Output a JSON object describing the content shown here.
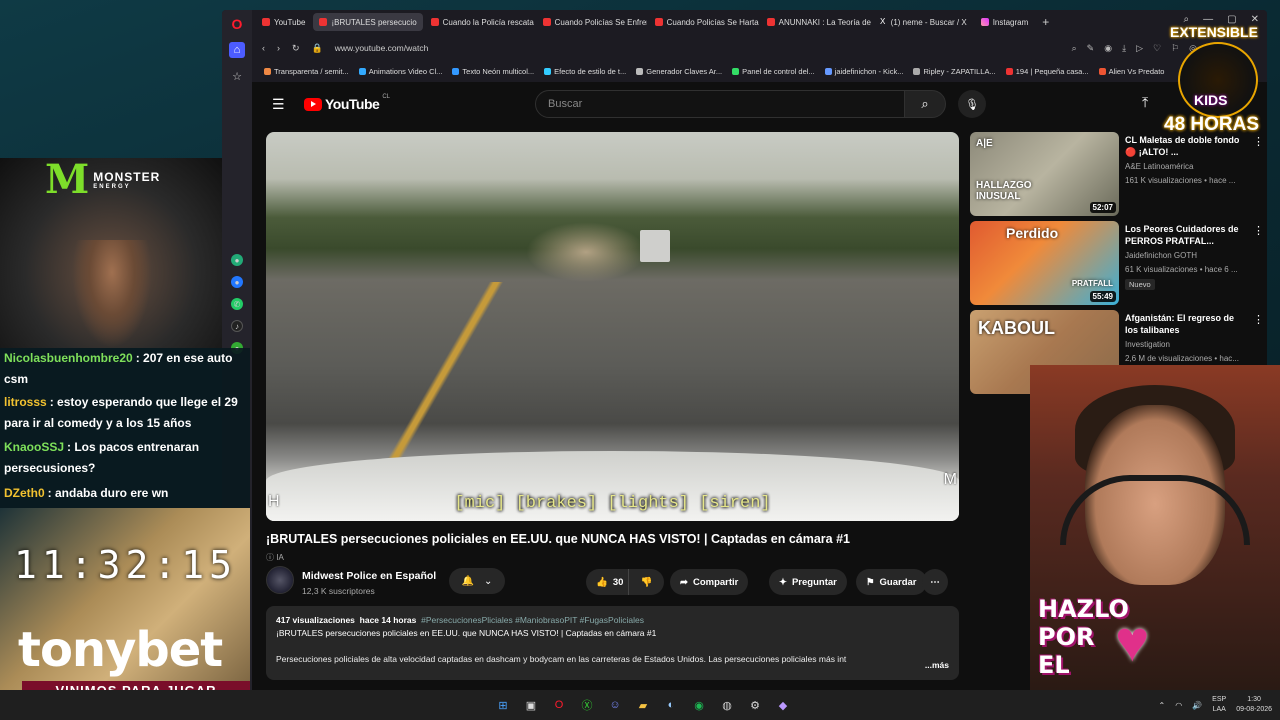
{
  "browser": {
    "tabs": [
      {
        "label": "YouTube",
        "icon": "youtube-icon"
      },
      {
        "label": "¡BRUTALES persecucio",
        "icon": "youtube-icon",
        "active": true
      },
      {
        "label": "Cuando la Policía rescata",
        "icon": "youtube-icon"
      },
      {
        "label": "Cuando Policías Se Enfren",
        "icon": "youtube-icon"
      },
      {
        "label": "Cuando Policías Se Hartan",
        "icon": "youtube-icon"
      },
      {
        "label": "ANUNNAKI : La Teoría de",
        "icon": "youtube-icon"
      },
      {
        "label": "(1) neme - Buscar / X",
        "icon": "x-icon"
      },
      {
        "label": "Instagram",
        "icon": "instagram-icon"
      }
    ],
    "url": "www.youtube.com/watch",
    "bookmarks": [
      "Transparenta / semit...",
      "Animations Video Cl...",
      "Texto Neón multicol...",
      "Efecto de estilo de t...",
      "Generador Claves Ar...",
      "Panel de control del...",
      "jaidefinichon - Kick...",
      "Ripley - ZAPATILLA...",
      "194 | Pequeña casa...",
      "Alien Vs Predato"
    ]
  },
  "youtube": {
    "logo_text": "YouTube",
    "logo_country": "CL",
    "search_placeholder": "Buscar",
    "video": {
      "subtitle": "[mic] [brakes] [lights] [siren]",
      "watermark_left": "H",
      "watermark_right": "M",
      "title": "¡BRUTALES persecuciones policiales en EE.UU. que NUNCA HAS VISTO! | Captadas en cámara #1",
      "ai_label": "IA",
      "channel": "Midwest Police en Español",
      "subscribers": "12,3 K suscriptores",
      "likes": "30",
      "share_label": "Compartir",
      "ask_label": "Preguntar",
      "save_label": "Guardar",
      "views": "417 visualizaciones",
      "age": "hace 14 horas",
      "tags": "#PersecucionesPliciales #ManiobrasoPIT #FugasPoliciales",
      "desc_line1": "¡BRUTALES persecuciones policiales en EE.UU. que NUNCA  HAS VISTO! | Captadas en cámara #1",
      "desc_body": "Persecuciones policiales de alta velocidad captadas en dashcam y bodycam en las carreteras de Estados Unidos. Las persecuciones policiales más int",
      "more_label": "...más"
    },
    "recommendations": [
      {
        "title": "CL Maletas de doble fondo 🔴 ¡ALTO! ...",
        "channel": "A&E Latinoamérica",
        "views": "161 K visualizaciones • hace ...",
        "duration": "52:07",
        "thumb_text": "HALLAZGO INUSUAL",
        "thumb_logo": "A|E",
        "badge": ""
      },
      {
        "title": "Los Peores Cuidadores de PERROS PRATFAL...",
        "channel": "Jaidefinichon GOTH",
        "views": "61 K visualizaciones • hace 6 ...",
        "duration": "55:49",
        "thumb_text": "Perdido",
        "thumb_logo": "PRATFALL",
        "badge": "Nuevo"
      },
      {
        "title": "Afganistán: El regreso de los talibanes",
        "channel": "Investigation",
        "views": "2,6 M de visualizaciones • hac...",
        "duration": "",
        "thumb_text": "KABOUL",
        "thumb_logo": "",
        "badge": ""
      }
    ]
  },
  "overlay": {
    "sponsor_logo": "MONSTER",
    "sponsor_sub": "ENERGY",
    "chat": [
      {
        "user": "Nicolasbuenhombre20",
        "msg": ": 207 en ese auto csm",
        "color": "#7ee05a"
      },
      {
        "user": "litrosss",
        "msg": ": estoy esperando que llege el 29 para ir al comedy y a los 15 años",
        "color": "#f2c230"
      },
      {
        "user": "KnaooSSJ",
        "msg": ": Los pacos entrenaran persecusiones?",
        "color": "#7ee05a"
      },
      {
        "user": "DZeth0",
        "msg": ": andaba duro ere wn",
        "color": "#f2c230"
      }
    ],
    "clock": "11:32:15",
    "brand": "tonybet",
    "brand_tagline": "VINIMOS PARA JUGAR",
    "badge_top": "EXTENSIBLE",
    "badge_mid": "KIDS",
    "badge_bottom": "48 HORAS",
    "avatar_text_1": "HAZLO",
    "avatar_text_2": "POR",
    "avatar_text_3": "EL"
  },
  "taskbar": {
    "lang_1": "ESP",
    "lang_2": "LAA",
    "time": "1:30",
    "date": "09-08-2026"
  },
  "colors": {
    "youtube_red": "#ff0000",
    "opera_red": "#ff1b2d",
    "monster_green": "#7dde2a",
    "tagline_bg": "#7a0e2a"
  }
}
